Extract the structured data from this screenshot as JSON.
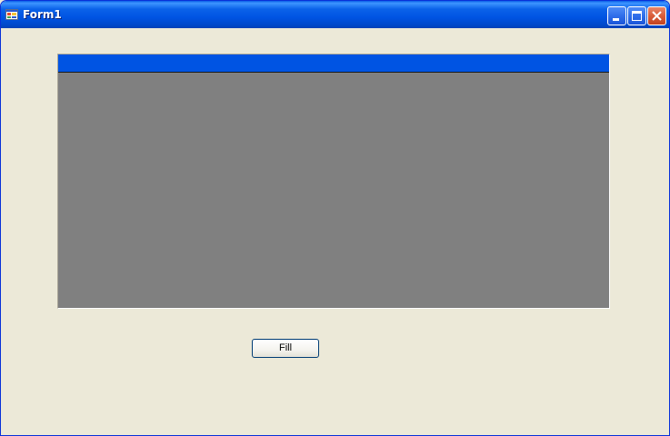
{
  "window": {
    "title": "Form1"
  },
  "titlebar_buttons": {
    "minimize_icon": "minimize-icon",
    "maximize_icon": "maximize-icon",
    "close_icon": "close-icon"
  },
  "grid": {
    "header_color": "#0054E3",
    "background_color": "#808080",
    "rows": []
  },
  "actions": {
    "fill_label": "Fill"
  }
}
